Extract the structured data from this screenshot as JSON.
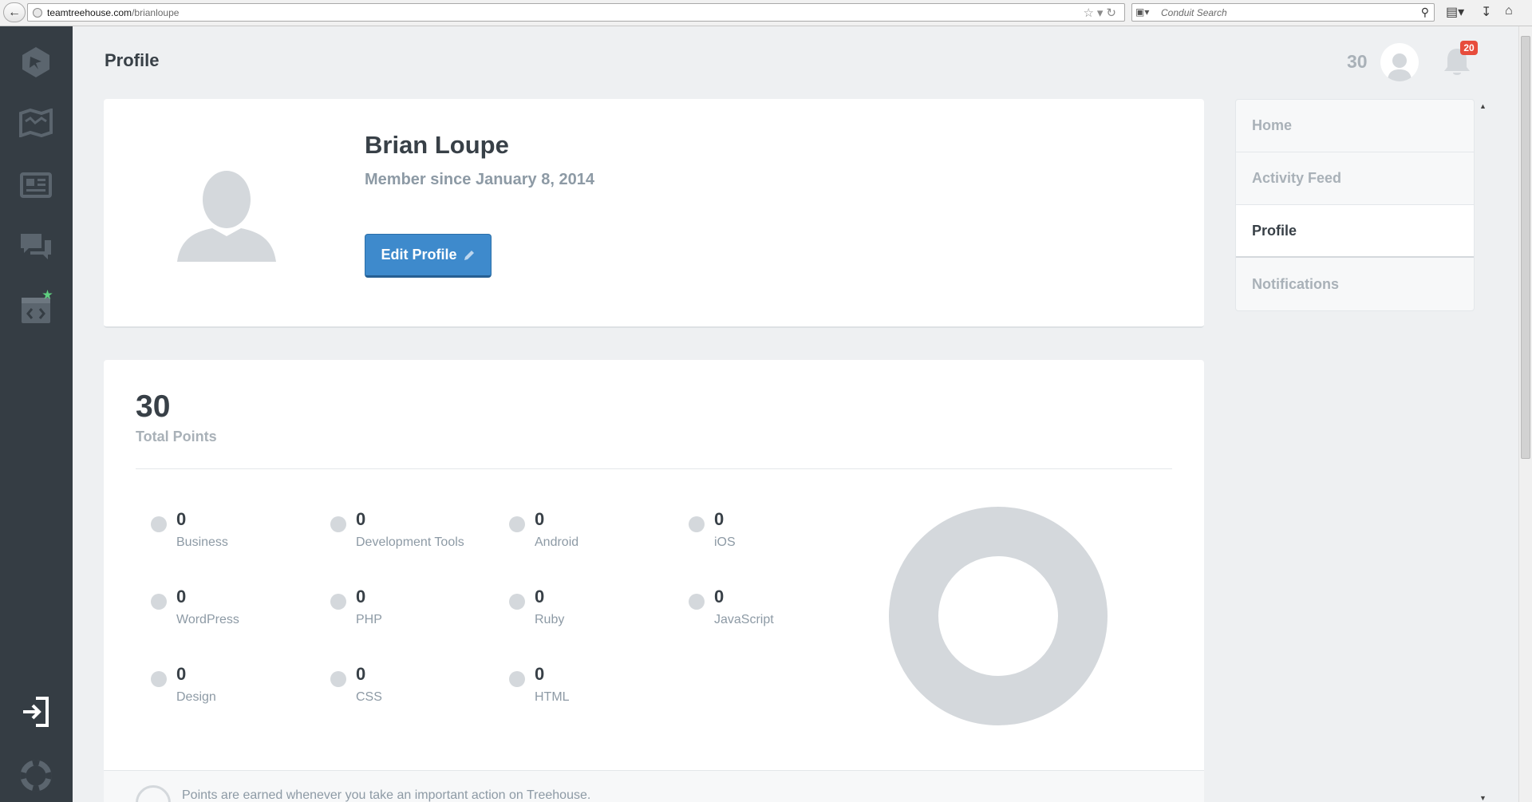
{
  "browser": {
    "url_domain": "teamtreehouse.com",
    "url_path": "/brianloupe",
    "search_engine_label": "Conduit Search"
  },
  "sidebar": {
    "items": [
      {
        "name": "treehouse-logo-icon"
      },
      {
        "name": "library-icon"
      },
      {
        "name": "tracks-icon"
      },
      {
        "name": "forum-icon"
      },
      {
        "name": "workspaces-icon"
      },
      {
        "name": "sign-out-icon"
      },
      {
        "name": "support-icon"
      }
    ],
    "new_indicator_color": "#5fcf80"
  },
  "header": {
    "title": "Profile",
    "points": "30",
    "notification_count": "20"
  },
  "profile": {
    "name": "Brian Loupe",
    "member_since": "Member since January 8, 2014",
    "edit_label": "Edit Profile"
  },
  "points": {
    "total": "30",
    "total_label": "Total Points",
    "categories": [
      {
        "value": "0",
        "name": "Business"
      },
      {
        "value": "0",
        "name": "Development Tools"
      },
      {
        "value": "0",
        "name": "Android"
      },
      {
        "value": "0",
        "name": "iOS"
      },
      {
        "value": "0",
        "name": "WordPress"
      },
      {
        "value": "0",
        "name": "PHP"
      },
      {
        "value": "0",
        "name": "Ruby"
      },
      {
        "value": "0",
        "name": "JavaScript"
      },
      {
        "value": "0",
        "name": "Design"
      },
      {
        "value": "0",
        "name": "CSS"
      },
      {
        "value": "0",
        "name": "HTML"
      }
    ],
    "footnote": "Points are earned whenever you take an important action on Treehouse."
  },
  "nav": {
    "items": [
      {
        "label": "Home",
        "active": false
      },
      {
        "label": "Activity Feed",
        "active": false
      },
      {
        "label": "Profile",
        "active": true
      },
      {
        "label": "Notifications",
        "active": false
      }
    ]
  },
  "colors": {
    "accent": "#3e8acc",
    "sidebar": "#353d44",
    "badge": "#e74c3c"
  }
}
